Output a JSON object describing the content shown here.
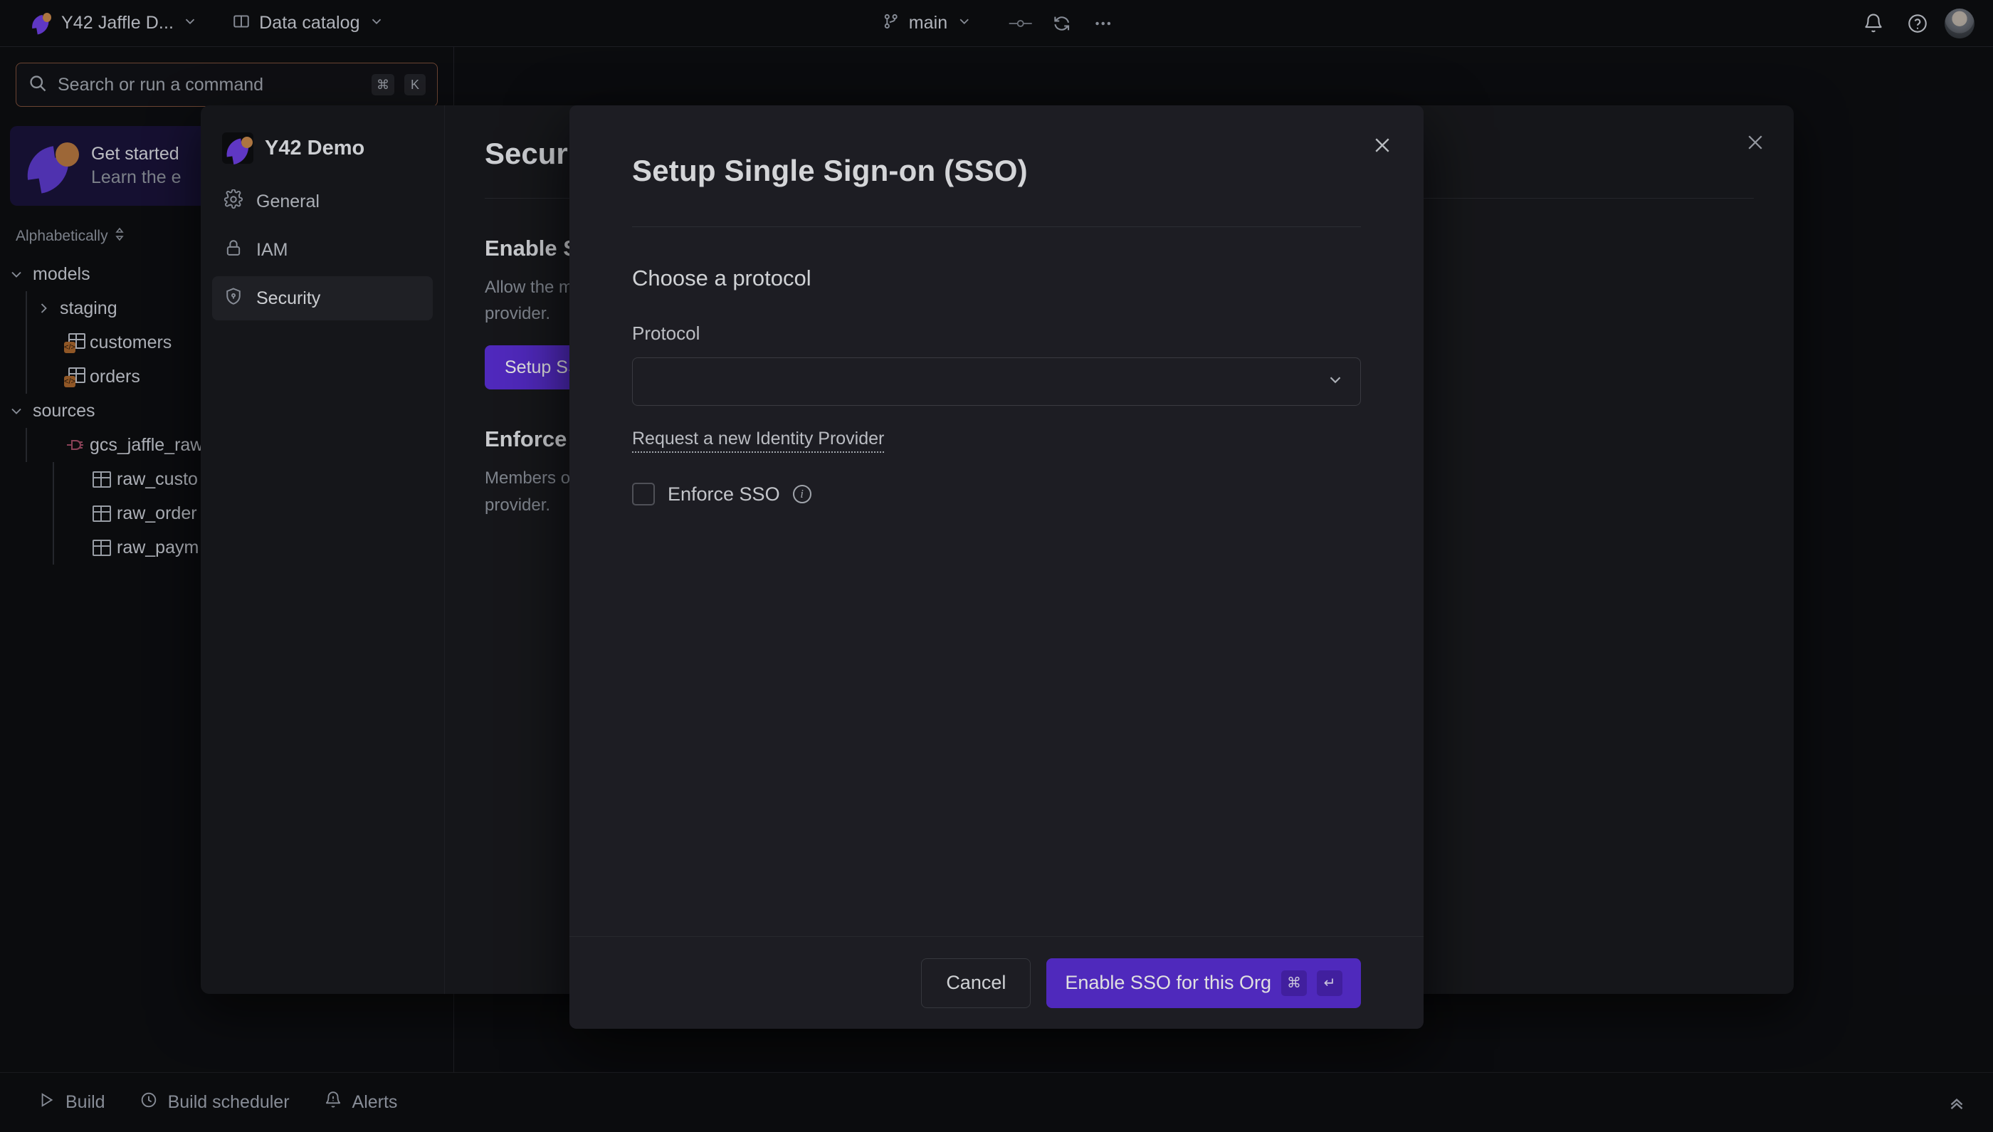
{
  "topbar": {
    "workspace_label": "Y42 Jaffle D...",
    "catalog_label": "Data catalog",
    "branch_label": "main",
    "icons": {
      "workspace_chevron": "chevron-down-icon",
      "catalog_icon": "book-icon",
      "catalog_chevron": "chevron-down-icon",
      "branch_icon": "git-branch-icon",
      "branch_chevron": "chevron-down-icon",
      "commit_icon": "commit-node-icon",
      "sync_icon": "refresh-sync-icon",
      "more_icon": "more-horizontal-icon",
      "bell_icon": "bell-icon",
      "help_icon": "help-circle-icon",
      "avatar": "user-avatar"
    }
  },
  "sidebar": {
    "search": {
      "placeholder": "Search or run a command",
      "kbd_cmd": "⌘",
      "kbd_key": "K"
    },
    "get_started": {
      "title": "Get started",
      "subtitle": "Learn the e"
    },
    "sort_label": "Alphabetically",
    "tree": [
      {
        "label": "models",
        "type": "folder",
        "depth": 1,
        "expanded": true
      },
      {
        "label": "staging",
        "type": "folder",
        "depth": 2,
        "expanded": false
      },
      {
        "label": "customers",
        "type": "model",
        "depth": 2
      },
      {
        "label": "orders",
        "type": "model",
        "depth": 2
      },
      {
        "label": "sources",
        "type": "folder",
        "depth": 1,
        "expanded": true
      },
      {
        "label": "gcs_jaffle_raw",
        "type": "source",
        "depth": 2
      },
      {
        "label": "raw_custo",
        "type": "table",
        "depth": 3
      },
      {
        "label": "raw_order",
        "type": "table",
        "depth": 3
      },
      {
        "label": "raw_paym",
        "type": "table",
        "depth": 3
      }
    ]
  },
  "settings_panel": {
    "org_name": "Y42 Demo",
    "nav": [
      {
        "label": "General",
        "icon": "gear-icon",
        "active": false
      },
      {
        "label": "IAM",
        "icon": "lock-icon",
        "active": false
      },
      {
        "label": "Security",
        "icon": "shield-icon",
        "active": true
      }
    ],
    "heading": "Security",
    "sections": [
      {
        "title": "Enable Single Sign-on (SSO)",
        "body": "Allow the members of this organization to sign in with your SSO provider.",
        "button": "Setup SSO"
      },
      {
        "title": "Enforce Single Sign-on (SSO)",
        "body": "Members of this organization must sign in through your Authentication provider.",
        "button": ""
      }
    ],
    "close_icon": "close-icon"
  },
  "modal": {
    "title": "Setup Single Sign-on (SSO)",
    "section_title": "Choose a protocol",
    "protocol_label": "Protocol",
    "protocol_value": "",
    "protocol_chevron": "chevron-down-icon",
    "request_link": "Request a new Identity Provider",
    "enforce_label": "Enforce SSO",
    "enforce_info_icon": "info-icon",
    "enforce_checked": false,
    "close_icon": "close-icon",
    "cancel_label": "Cancel",
    "submit_label": "Enable SSO for this Org",
    "submit_kbd_cmd": "⌘",
    "submit_kbd_enter": "↵"
  },
  "bottombar": {
    "items": [
      {
        "label": "Build",
        "icon": "play-icon"
      },
      {
        "label": "Build scheduler",
        "icon": "clock-icon"
      },
      {
        "label": "Alerts",
        "icon": "bell-alert-icon"
      }
    ],
    "collapse_icon": "chevrons-up-icon"
  },
  "colors": {
    "accent_purple": "#5b2fd6",
    "brand_orange": "#c4864a",
    "app_bg": "#0d0e11",
    "panel_bg": "#191a1e",
    "modal_bg": "#212228",
    "search_focus_border": "#7a4e3a"
  }
}
